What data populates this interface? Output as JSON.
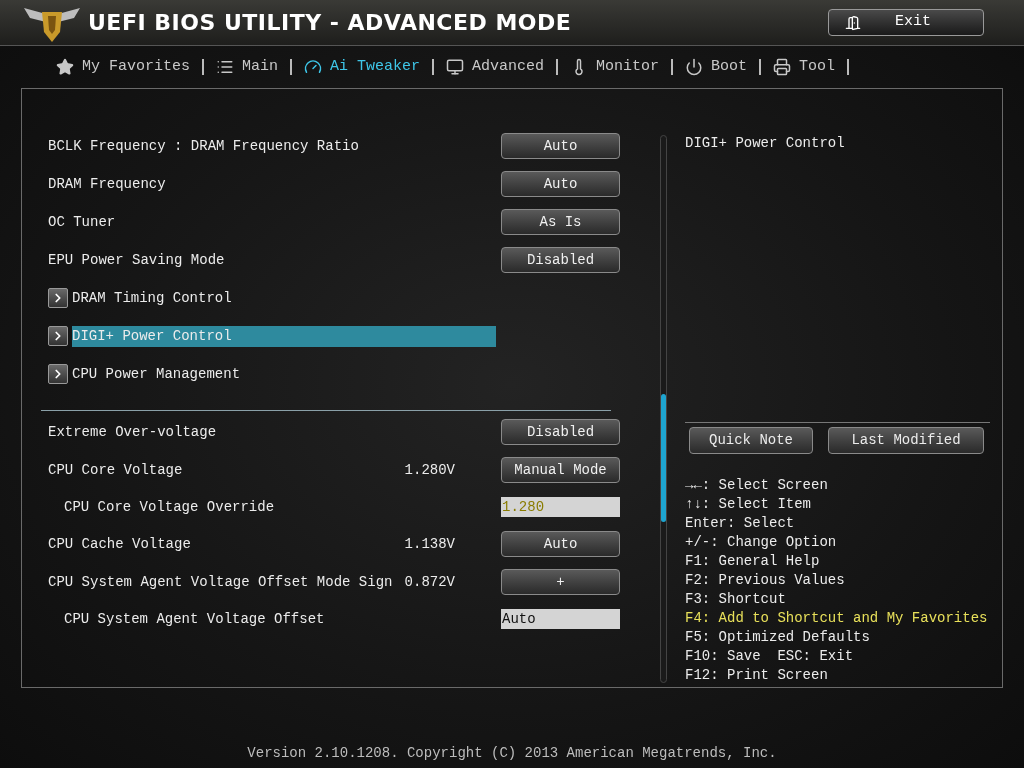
{
  "header": {
    "title": "UEFI BIOS UTILITY - ADVANCED MODE",
    "exit_button": "Exit"
  },
  "tabs": [
    {
      "kind": "favorites",
      "label": "My Favorites",
      "selected": false
    },
    {
      "kind": "main",
      "label": "Main",
      "selected": false
    },
    {
      "kind": "tweaker",
      "label": "Ai Tweaker",
      "selected": true
    },
    {
      "kind": "advanced",
      "label": "Advanced",
      "selected": false
    },
    {
      "kind": "monitor",
      "label": "Monitor",
      "selected": false
    },
    {
      "kind": "boot",
      "label": "Boot",
      "selected": false
    },
    {
      "kind": "tool",
      "label": "Tool",
      "selected": false
    }
  ],
  "settings": [
    {
      "kind": "button",
      "label": "BCLK Frequency : DRAM Frequency Ratio",
      "control": "Auto",
      "selected": false
    },
    {
      "kind": "button",
      "label": "DRAM Frequency",
      "control": "Auto",
      "selected": false
    },
    {
      "kind": "button",
      "label": "OC Tuner",
      "control": "As Is",
      "selected": false
    },
    {
      "kind": "button",
      "label": "EPU Power Saving Mode",
      "control": "Disabled",
      "selected": false
    },
    {
      "kind": "submenu",
      "label": "DRAM Timing Control",
      "selected": false
    },
    {
      "kind": "submenu",
      "label": "DIGI+ Power Control",
      "selected": true
    },
    {
      "kind": "submenu",
      "label": "CPU Power Management",
      "selected": false
    }
  ],
  "voltage_settings": [
    {
      "kind": "button",
      "label": "Extreme Over-voltage",
      "control": "Disabled",
      "selected": false
    },
    {
      "kind": "button",
      "label": "CPU Core Voltage",
      "reading": "1.280V",
      "control": "Manual Mode",
      "selected": false,
      "children": [
        {
          "kind": "field",
          "label": "CPU Core Voltage Override",
          "value": "1.280",
          "highlighted": true,
          "selected": false
        }
      ]
    },
    {
      "kind": "button",
      "label": "CPU Cache Voltage",
      "reading": "1.138V",
      "control": "Auto",
      "selected": false
    },
    {
      "kind": "button",
      "label": "CPU System Agent Voltage Offset Mode Sign",
      "reading": "0.872V",
      "control": "+",
      "selected": false,
      "children": [
        {
          "kind": "field",
          "label": "CPU System Agent Voltage Offset",
          "value": "Auto",
          "highlighted": false,
          "selected": false
        }
      ]
    }
  ],
  "help": {
    "title": "DIGI+ Power Control",
    "buttons": [
      "Quick Note",
      "Last Modified"
    ],
    "keys": [
      {
        "text": "→←: Select Screen",
        "highlighted": false
      },
      {
        "text": "↑↓: Select Item",
        "highlighted": false
      },
      {
        "text": "Enter: Select",
        "highlighted": false
      },
      {
        "text": "+/-: Change Option",
        "highlighted": false
      },
      {
        "text": "F1: General Help",
        "highlighted": false
      },
      {
        "text": "F2: Previous Values",
        "highlighted": false
      },
      {
        "text": "F3: Shortcut",
        "highlighted": false
      },
      {
        "text": "F4: Add to Shortcut and My Favorites",
        "highlighted": true
      },
      {
        "text": "F5: Optimized Defaults",
        "highlighted": false
      },
      {
        "text": "F10: Save  ESC: Exit",
        "highlighted": false
      },
      {
        "text": "F12: Print Screen",
        "highlighted": false
      }
    ]
  },
  "footer": "Version 2.10.1208. Copyright (C) 2013 American Megatrends, Inc."
}
